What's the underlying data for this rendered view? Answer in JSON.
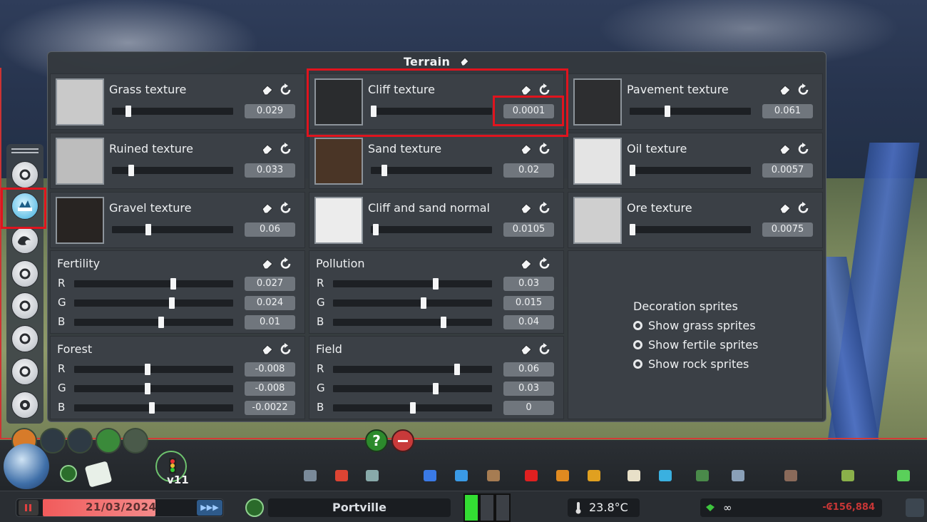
{
  "panel": {
    "title": "Terrain",
    "textures": [
      {
        "label": "Grass texture",
        "value": "0.029",
        "swatch": "#c9c9c9",
        "thumb_pos": 0.12
      },
      {
        "label": "Cliff texture",
        "value": "0.0001",
        "swatch": "#2a2c2e",
        "thumb_pos": 0.0
      },
      {
        "label": "Pavement texture",
        "value": "0.061",
        "swatch": "#2d2e30",
        "thumb_pos": 0.3
      },
      {
        "label": "Ruined texture",
        "value": "0.033",
        "swatch": "#bdbdbd",
        "thumb_pos": 0.14
      },
      {
        "label": "Sand texture",
        "value": "0.02",
        "swatch": "#4a3526",
        "thumb_pos": 0.09
      },
      {
        "label": "Oil texture",
        "value": "0.0057",
        "swatch": "#e4e4e4",
        "thumb_pos": 0.0
      },
      {
        "label": "Gravel texture",
        "value": "0.06",
        "swatch": "#282422",
        "thumb_pos": 0.29
      },
      {
        "label": "Cliff and sand normal",
        "value": "0.0105",
        "swatch": "#ececec",
        "thumb_pos": 0.02
      },
      {
        "label": "Ore texture",
        "value": "0.0075",
        "swatch": "#cfcfcf",
        "thumb_pos": 0.0
      }
    ],
    "rgb_groups": [
      {
        "label": "Fertility",
        "channels": [
          {
            "name": "R",
            "value": "0.027",
            "thumb_pos": 0.63
          },
          {
            "name": "G",
            "value": "0.024",
            "thumb_pos": 0.62
          },
          {
            "name": "B",
            "value": "0.01",
            "thumb_pos": 0.55
          }
        ]
      },
      {
        "label": "Pollution",
        "channels": [
          {
            "name": "R",
            "value": "0.03",
            "thumb_pos": 0.65
          },
          {
            "name": "G",
            "value": "0.015",
            "thumb_pos": 0.57
          },
          {
            "name": "B",
            "value": "0.04",
            "thumb_pos": 0.7
          }
        ]
      },
      {
        "label": "Forest",
        "channels": [
          {
            "name": "R",
            "value": "-0.008",
            "thumb_pos": 0.46
          },
          {
            "name": "G",
            "value": "-0.008",
            "thumb_pos": 0.46
          },
          {
            "name": "B",
            "value": "-0.0022",
            "thumb_pos": 0.49
          }
        ]
      },
      {
        "label": "Field",
        "channels": [
          {
            "name": "R",
            "value": "0.06",
            "thumb_pos": 0.79
          },
          {
            "name": "G",
            "value": "0.03",
            "thumb_pos": 0.65
          },
          {
            "name": "B",
            "value": "0",
            "thumb_pos": 0.5
          }
        ]
      }
    ],
    "decoration": {
      "title": "Decoration sprites",
      "options": [
        "Show grass sprites",
        "Show fertile sprites",
        "Show rock sprites"
      ]
    }
  },
  "left_toolbar": {
    "buttons": [
      "theme-icon",
      "terrain-icon",
      "water-icon",
      "buildings-icon",
      "gear-ring-icon",
      "weather-icon",
      "atmosphere-icon",
      "settings-icon"
    ],
    "selected": "terrain-icon"
  },
  "status": {
    "date": "21/03/2024",
    "city": "Portville",
    "temperature": "23.8°C",
    "money_symbol": "∞",
    "balance": "-₢156,884",
    "version": "v11"
  },
  "toolbar_icons": [
    "roads-icon",
    "zoning-icon",
    "districts-icon",
    "electricity-icon",
    "water-icon",
    "garbage-icon",
    "healthcare-icon",
    "fire-icon",
    "police-icon",
    "education-icon",
    "transport-icon",
    "beautification-icon",
    "monuments-icon",
    "wonders-icon",
    "landscaping-icon",
    "money-icon"
  ],
  "colors": {
    "highlight": "#e0141e",
    "panel_bg": "#34393e",
    "cell_bg": "#3b4046",
    "value_bg": "#70767d"
  }
}
